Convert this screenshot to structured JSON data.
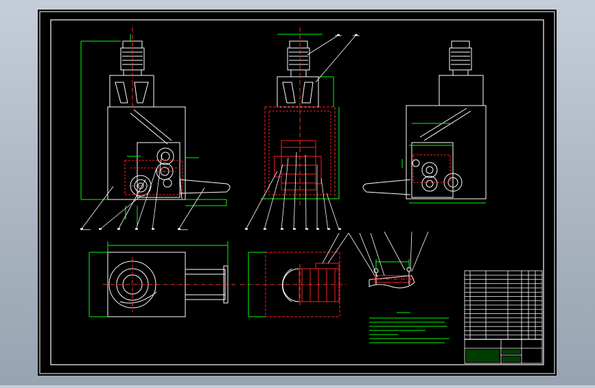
{
  "colors": {
    "background": "#000000",
    "frame": "#ffffff",
    "outline": "#ffffff",
    "hidden": "#ff2020",
    "dimension": "#00ff00",
    "leader": "#ffffff",
    "centerline": "#ff3030",
    "notes": "#00ff00",
    "title_grid": "#ffffff",
    "title_fill": "#00aa00"
  },
  "icons": {
    "motor": "motor-icon",
    "gear": "gear-icon",
    "balloon": "balloon-callout-icon"
  },
  "drawing": {
    "views": [
      {
        "id": "front-view"
      },
      {
        "id": "side-view"
      },
      {
        "id": "rear-view"
      },
      {
        "id": "top-view"
      },
      {
        "id": "section-view"
      },
      {
        "id": "detail-view"
      }
    ],
    "leader_count_front": 6,
    "leader_count_side": 8,
    "leader_count_detail": 6
  },
  "notes": {
    "line_count": 8
  },
  "title_block": {
    "parts_rows": 16,
    "columns": 6
  }
}
